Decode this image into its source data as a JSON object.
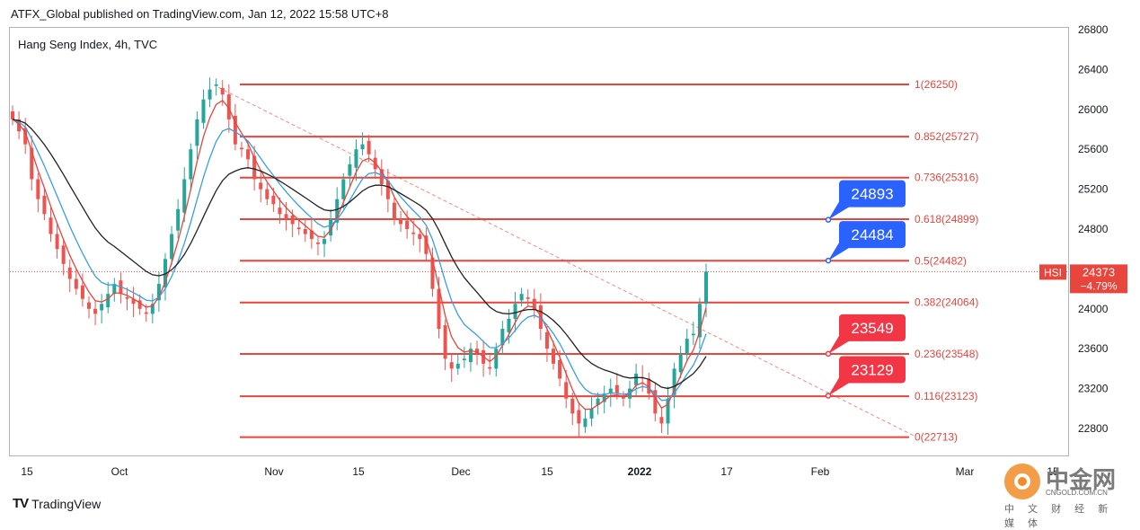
{
  "header": {
    "publisher_line": "ATFX_Global published on TradingView.com, Jan 12, 2022 15:58 UTC+8"
  },
  "chart_data": {
    "type": "candlestick",
    "title": "Hang Seng Index, 4h, TVC",
    "symbol": "HSI",
    "last_price": "24373",
    "change": "−4.79%",
    "ylim": [
      22600,
      26800
    ],
    "y_ticks": [
      "26800",
      "26400",
      "26000",
      "25600",
      "25200",
      "24800",
      "24400",
      "24000",
      "23600",
      "23200",
      "22800"
    ],
    "x_ticks": [
      "15",
      "Oct",
      "Nov",
      "15",
      "Dec",
      "15",
      "2022",
      "17",
      "Feb",
      "Mar",
      "15"
    ],
    "fibonacci_levels": [
      {
        "label": "1(26250)",
        "value": 26250
      },
      {
        "label": "0.852(25727)",
        "value": 25727
      },
      {
        "label": "0.736(25316)",
        "value": 25316
      },
      {
        "label": "0.618(24899)",
        "value": 24899
      },
      {
        "label": "0.5(24482)",
        "value": 24482
      },
      {
        "label": "0.382(24064)",
        "value": 24064
      },
      {
        "label": "0.236(23548)",
        "value": 23548
      },
      {
        "label": "0.116(23123)",
        "value": 23123
      },
      {
        "label": "0(22713)",
        "value": 22713
      }
    ],
    "callouts": [
      {
        "text": "24893",
        "value": 24893,
        "color": "#2962ff"
      },
      {
        "text": "24484",
        "value": 24484,
        "color": "#2962ff"
      },
      {
        "text": "23549",
        "value": 23549,
        "color": "#f23645"
      },
      {
        "text": "23129",
        "value": 23129,
        "color": "#f23645"
      }
    ],
    "trendline": {
      "from": [
        0.197,
        26220
      ],
      "to": [
        0.855,
        22720
      ],
      "style": "dashed"
    },
    "close_series": [
      25900,
      25780,
      25650,
      25300,
      25100,
      24950,
      24750,
      24600,
      24450,
      24300,
      24200,
      24100,
      24000,
      23950,
      24050,
      24150,
      24250,
      24150,
      24100,
      24050,
      24000,
      23950,
      24050,
      24250,
      24500,
      24750,
      25000,
      25300,
      25600,
      25900,
      26100,
      26200,
      26250,
      26150,
      25900,
      25650,
      25600,
      25500,
      25300,
      25200,
      25100,
      25050,
      24950,
      24900,
      24850,
      24800,
      24750,
      24700,
      24650,
      24700,
      24900,
      25100,
      25300,
      25450,
      25600,
      25650,
      25550,
      25400,
      25250,
      25100,
      24900,
      24850,
      24800,
      24750,
      24700,
      24550,
      24200,
      23800,
      23500,
      23400,
      23450,
      23500,
      23600,
      23550,
      23450,
      23400,
      23600,
      23800,
      23900,
      24050,
      24150,
      24100,
      24000,
      23800,
      23600,
      23450,
      23300,
      23100,
      22950,
      22850,
      22900,
      23000,
      23100,
      23150,
      23200,
      23150,
      23100,
      23200,
      23350,
      23300,
      23150,
      22950,
      22850,
      23100,
      23400,
      23550,
      23700,
      23750,
      24050,
      24373
    ],
    "series": [
      {
        "name": "MA fast",
        "color": "#e8453c"
      },
      {
        "name": "MA mid",
        "color": "#3a9ee0"
      },
      {
        "name": "MA slow",
        "color": "#222222"
      }
    ]
  },
  "footer": {
    "brand": "TradingView"
  },
  "watermark": {
    "name": "中金网",
    "url": "CNGOLD.COM.CN",
    "sub": "中 文 财 经 新 媒 体"
  }
}
